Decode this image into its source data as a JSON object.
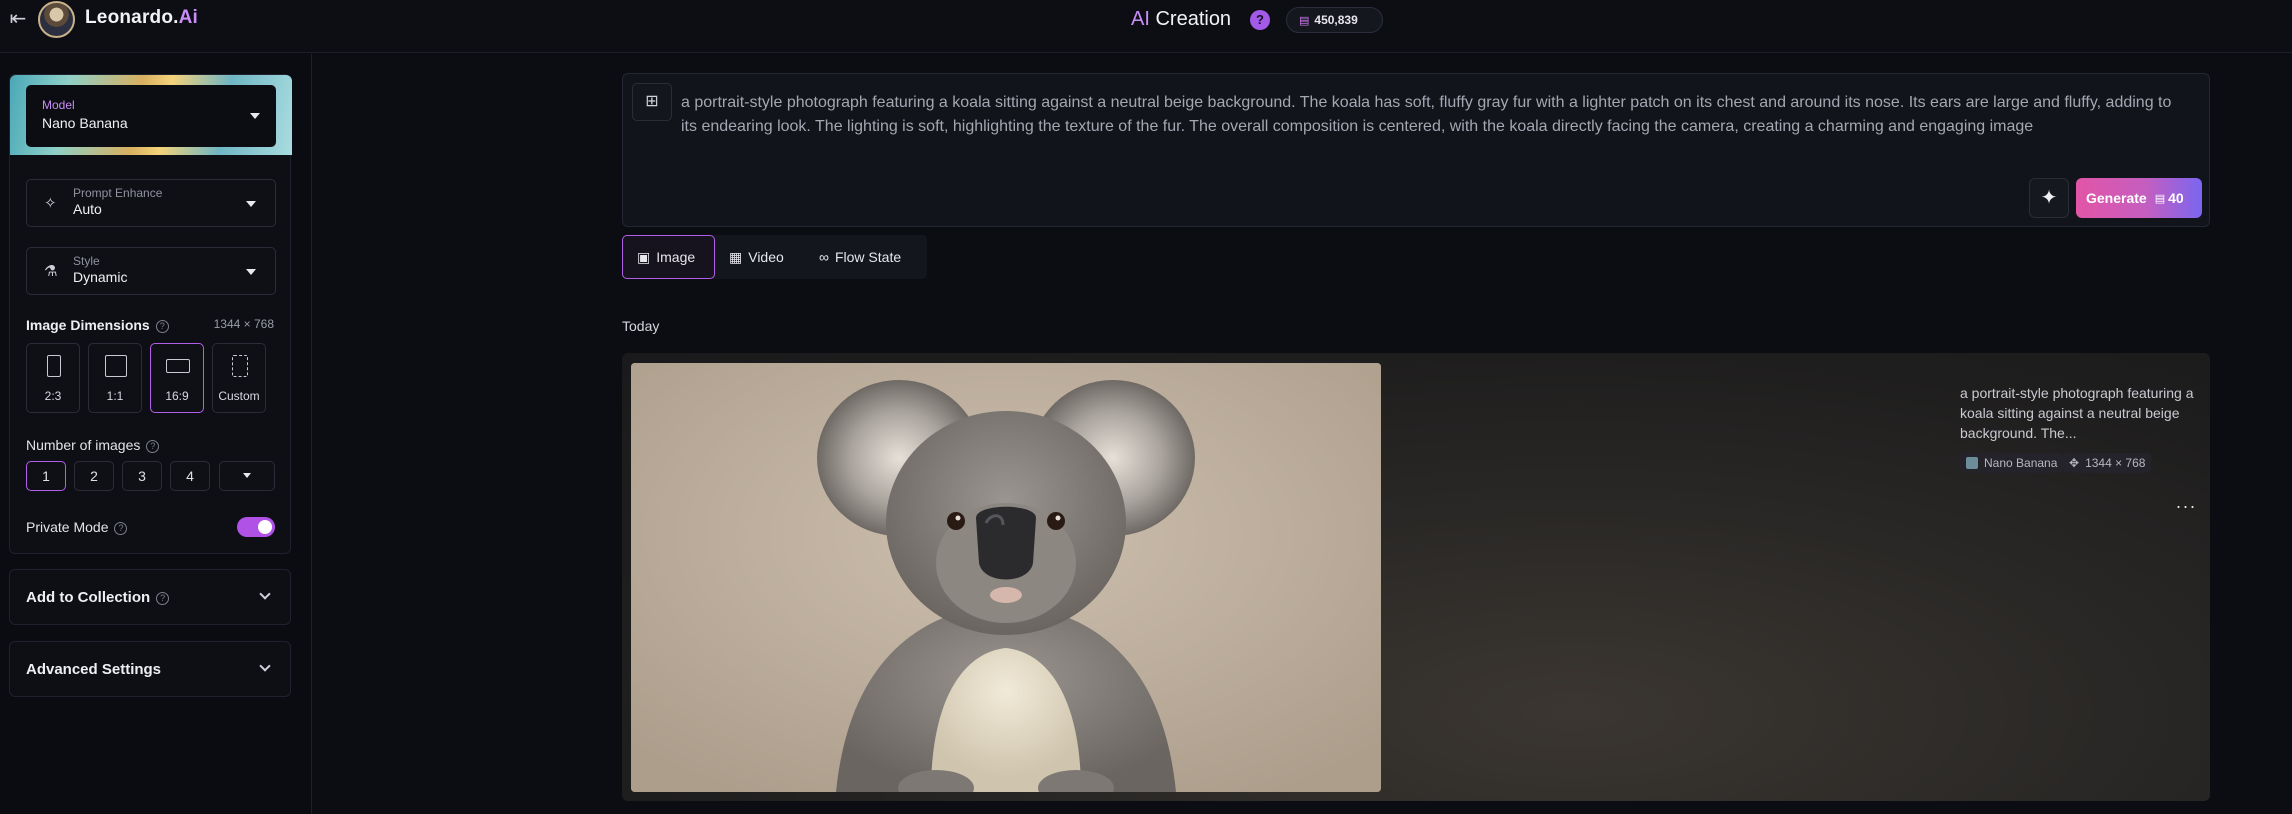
{
  "header": {
    "brand_main": "Leonardo.",
    "brand_ai": "Ai",
    "title_ai": "AI",
    "title_rest": " Creation",
    "help": "?",
    "credits": "450,839"
  },
  "sidebar": {
    "model": {
      "label": "Model",
      "value": "Nano Banana"
    },
    "prompt_enhance": {
      "label": "Prompt Enhance",
      "value": "Auto",
      "icon": "sparkle-icon"
    },
    "style": {
      "label": "Style",
      "value": "Dynamic",
      "icon": "flask-icon"
    },
    "dimensions": {
      "title": "Image Dimensions",
      "value": "1344 × 768",
      "options": [
        {
          "label": "2:3"
        },
        {
          "label": "1:1"
        },
        {
          "label": "16:9",
          "selected": true
        },
        {
          "label": "Custom"
        }
      ]
    },
    "num_images": {
      "title": "Number of images",
      "options": [
        "1",
        "2",
        "3",
        "4"
      ],
      "selected": "1"
    },
    "private_mode": {
      "title": "Private Mode",
      "enabled": true
    },
    "add_to_collection": "Add to Collection",
    "advanced_settings": "Advanced Settings"
  },
  "prompt": {
    "text": "a portrait-style photograph featuring a koala sitting against a neutral beige background. The koala has soft, fluffy gray fur with a lighter patch on its chest and around its nose. Its ears are large and fluffy, adding to its endearing look. The lighting is soft, highlighting the texture of the fur. The overall composition is centered, with the koala directly facing the camera, creating a charming and engaging image",
    "generate_label": "Generate",
    "generate_cost": "40"
  },
  "mode_tabs": [
    {
      "label": "Image",
      "icon": "image-icon",
      "active": true
    },
    {
      "label": "Video",
      "icon": "video-icon",
      "active": false
    },
    {
      "label": "Flow State",
      "icon": "infinity-icon",
      "active": false
    }
  ],
  "history": {
    "date_label": "Today",
    "items": [
      {
        "caption": "a portrait-style photograph featuring a koala sitting against a neutral beige background. The...",
        "model": "Nano Banana",
        "size": "1344 × 768",
        "more": "···"
      }
    ]
  },
  "colors": {
    "accent": "#b35ee6",
    "generate_start": "#e255a6",
    "generate_end": "#7a66f0",
    "background": "#0c0d12"
  }
}
